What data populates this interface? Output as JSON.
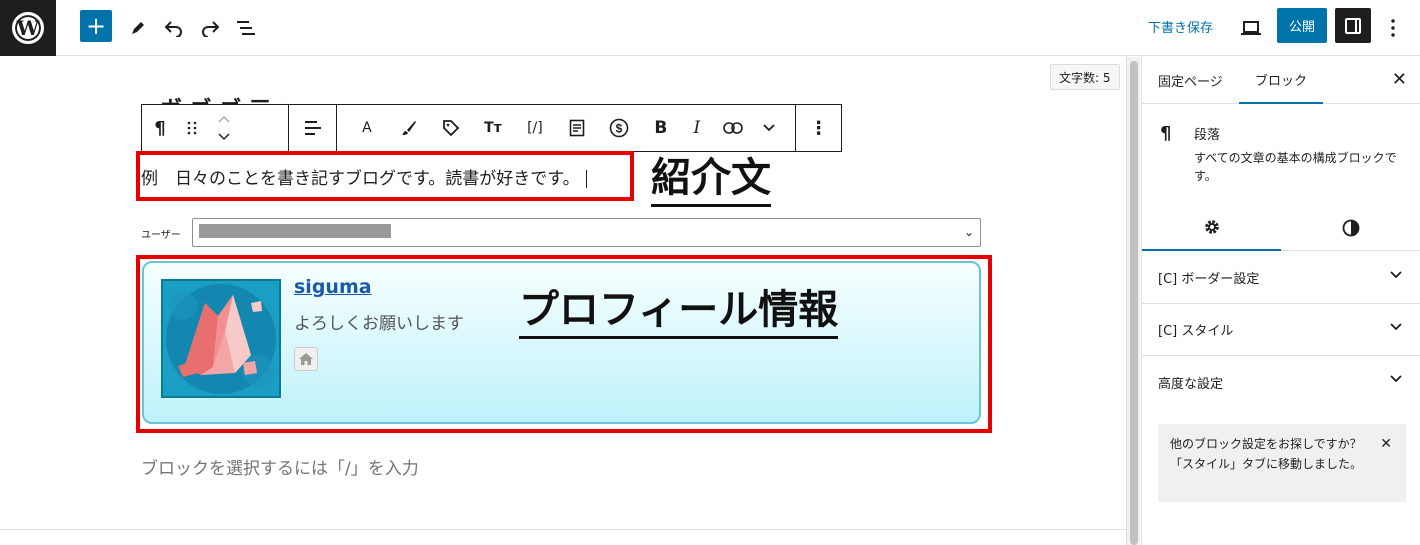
{
  "topbar": {
    "logo_letter": "W",
    "add_button": "+",
    "draft_label": "下書き保存",
    "publish_label": "公開"
  },
  "editor": {
    "word_count": "文字数: 5",
    "intro_text": "例　日々のことを書き記すブログです。読書が好きです。",
    "label_intro": "紹介文",
    "user_label": "ユーザー",
    "profile": {
      "name": "siguma",
      "description": "よろしくお願いします"
    },
    "label_profile": "プロフィール情報",
    "placeholder": "ブロックを選択するには「/」を入力"
  },
  "toolbar": {
    "paragraph_icon": "¶",
    "font_icon": "A",
    "tt_icon": "Tт",
    "shortcode_icon": "[/]",
    "bold": "B",
    "italic": "I",
    "more": "⋮"
  },
  "sidebar": {
    "tabs": [
      {
        "label": "固定ページ",
        "active": false
      },
      {
        "label": "ブロック",
        "active": true
      }
    ],
    "close": "✕",
    "block": {
      "icon": "¶",
      "title": "段落",
      "description": "すべての文章の基本の構成ブロックです。"
    },
    "panels": [
      "[C] ボーダー設定",
      "[C] スタイル",
      "高度な設定"
    ],
    "notice": "他のブロック設定をお探しですか？「スタイル」タブに移動しました。",
    "notice_close": "✕"
  },
  "colors": {
    "accent": "#0073aa",
    "highlight_red": "#e60000",
    "card_gradient_end": "#bff2fb"
  }
}
